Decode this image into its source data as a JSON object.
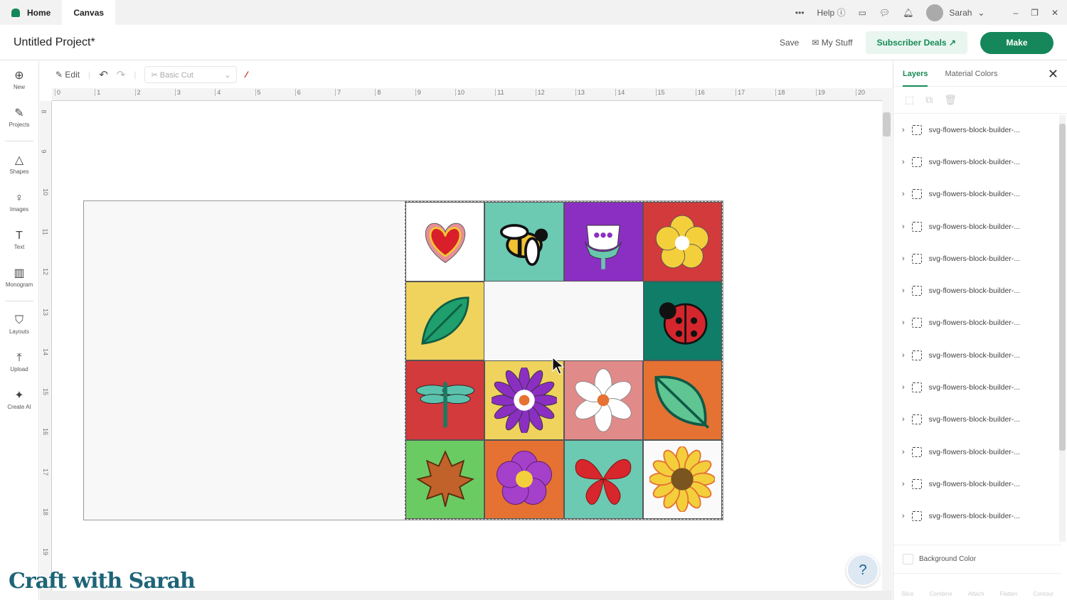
{
  "titlebar": {
    "home": "Home",
    "canvas": "Canvas",
    "help": "Help",
    "user": "Sarah"
  },
  "header": {
    "title": "Untitled Project*",
    "save": "Save",
    "my_stuff": "My Stuff",
    "deals": "Subscriber Deals",
    "make": "Make"
  },
  "sidebar": [
    {
      "label": "New",
      "icon": "⊕"
    },
    {
      "label": "Projects",
      "icon": "✎"
    },
    {
      "label": "Shapes",
      "icon": "△"
    },
    {
      "label": "Images",
      "icon": "♀"
    },
    {
      "label": "Text",
      "icon": "T"
    },
    {
      "label": "Monogram",
      "icon": "▥"
    },
    {
      "label": "Layouts",
      "icon": "⛉"
    },
    {
      "label": "Upload",
      "icon": "⤒"
    },
    {
      "label": "Create AI",
      "icon": "✦"
    }
  ],
  "toolbar": {
    "edit": "Edit",
    "operation": "Basic Cut"
  },
  "ruler": {
    "top": [
      "0",
      "1",
      "2",
      "3",
      "4",
      "5",
      "6",
      "7",
      "8",
      "9",
      "10",
      "11",
      "12",
      "13",
      "14",
      "15",
      "16",
      "17",
      "18",
      "19",
      "20"
    ],
    "left": [
      "8",
      "9",
      "10",
      "11",
      "12",
      "13",
      "14",
      "15",
      "16",
      "17",
      "18",
      "19"
    ]
  },
  "tiles": [
    {
      "bg": "#ffffff",
      "icon": "heart"
    },
    {
      "bg": "#6cc9b2",
      "icon": "bee"
    },
    {
      "bg": "#8b2fc2",
      "icon": "tulip"
    },
    {
      "bg": "#d23a3c",
      "icon": "flower-yellow"
    },
    {
      "bg": "#f0d35c",
      "icon": "leaf"
    },
    {
      "bg": "",
      "icon": ""
    },
    {
      "bg": "",
      "icon": ""
    },
    {
      "bg": "#0f7d68",
      "icon": "ladybug"
    },
    {
      "bg": "#d23a3c",
      "icon": "dragonfly"
    },
    {
      "bg": "#f0d35c",
      "icon": "flower-purple"
    },
    {
      "bg": "#e08a8a",
      "icon": "flower-white"
    },
    {
      "bg": "#e57232",
      "icon": "leaf-green"
    },
    {
      "bg": "#6bcb63",
      "icon": "maple-leaf"
    },
    {
      "bg": "#e57232",
      "icon": "flower-violet"
    },
    {
      "bg": "#6cc9b2",
      "icon": "butterfly"
    },
    {
      "bg": "#fafafa",
      "icon": "sunflower"
    }
  ],
  "panel": {
    "tab_layers": "Layers",
    "tab_colors": "Material Colors",
    "layer_name": "svg-flowers-block-builder-...",
    "layer_count": 13,
    "background_color": "Background Color",
    "actions": [
      "Slice",
      "Combine",
      "Attach",
      "Flatten",
      "Contour"
    ]
  },
  "logo": "Craft with Sarah"
}
